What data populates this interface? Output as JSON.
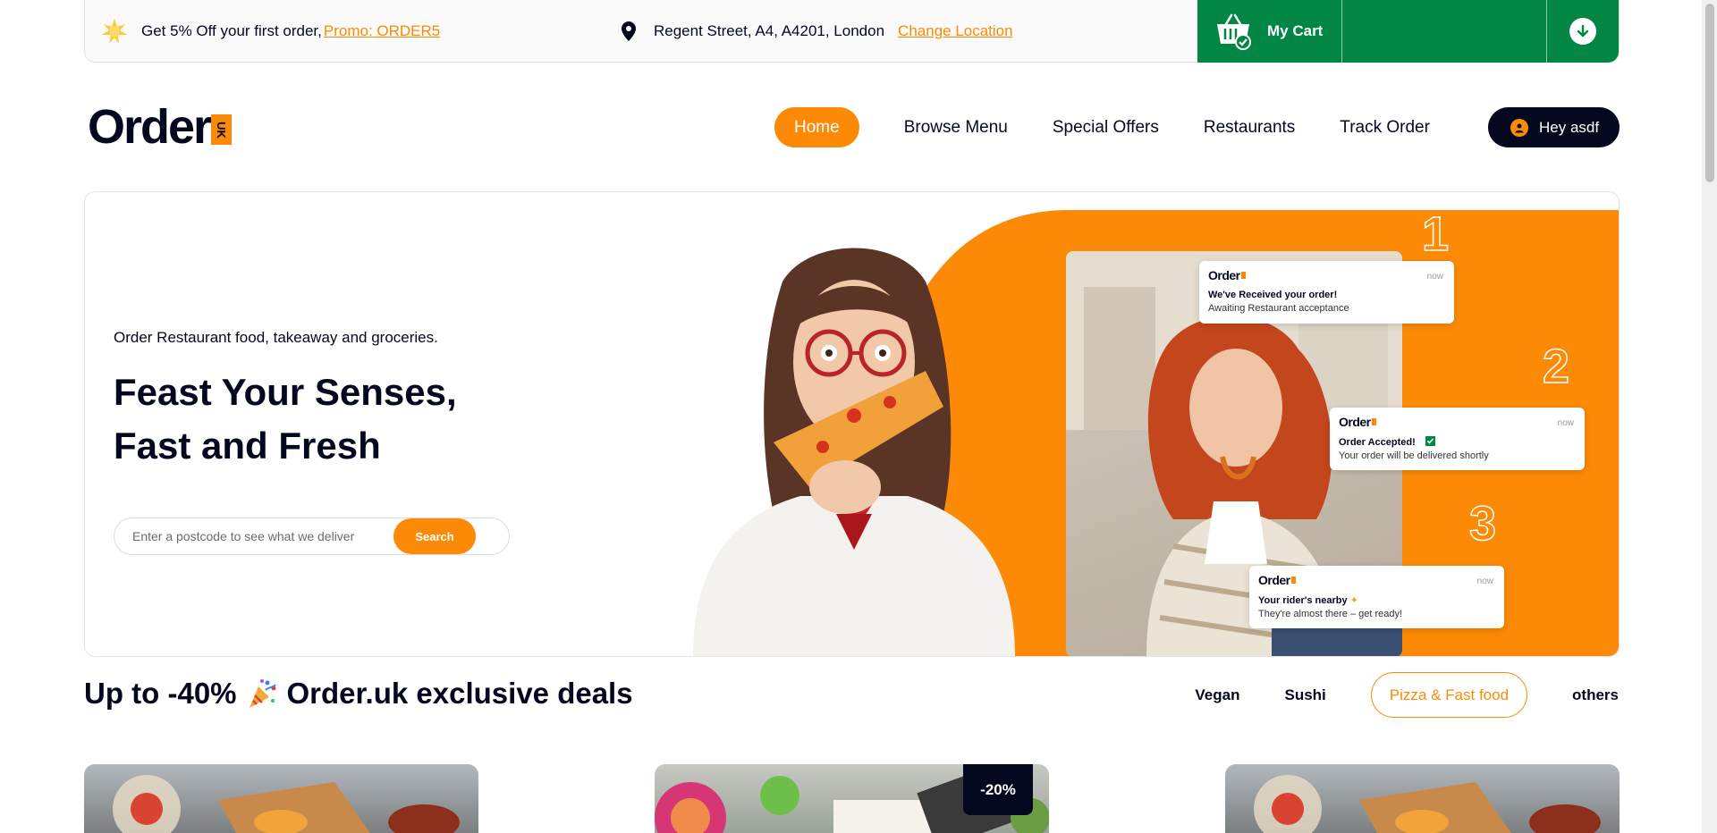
{
  "topbar": {
    "promo_text": "Get 5% Off your first order,",
    "promo_link": "Promo: ORDER5",
    "location": "Regent Street, A4, A4201, London",
    "change_location": "Change Location",
    "cart_label": "My Cart"
  },
  "logo": {
    "word": "Order",
    "badge": "UK"
  },
  "nav": {
    "items": [
      "Home",
      "Browse Menu",
      "Special Offers",
      "Restaurants",
      "Track Order"
    ],
    "account": "Hey asdf"
  },
  "hero": {
    "subtitle": "Order Restaurant food, takeaway and groceries.",
    "title_line1": "Feast Your Senses,",
    "title_line2": "Fast and Fresh",
    "search_placeholder": "Enter a postcode to see what we deliver",
    "search_button": "Search",
    "steps": [
      "1",
      "2",
      "3"
    ],
    "notifications": [
      {
        "logo": "Order",
        "time": "now",
        "title": "We've Received your order!",
        "body": "Awaiting Restaurant acceptance"
      },
      {
        "logo": "Order",
        "time": "now",
        "title": "Order Accepted!",
        "body": "Your order will be delivered shortly"
      },
      {
        "logo": "Order",
        "time": "now",
        "title": "Your rider's nearby",
        "body": "They're almost there – get ready!"
      }
    ]
  },
  "deals": {
    "title_prefix": "Up to -40%",
    "title_suffix": "Order.uk exclusive deals",
    "categories": [
      "Vegan",
      "Sushi",
      "Pizza & Fast food",
      "others"
    ],
    "card_discount": "-20%"
  },
  "colors": {
    "orange": "#fc8a06",
    "navy": "#03081f",
    "green": "#028643"
  }
}
